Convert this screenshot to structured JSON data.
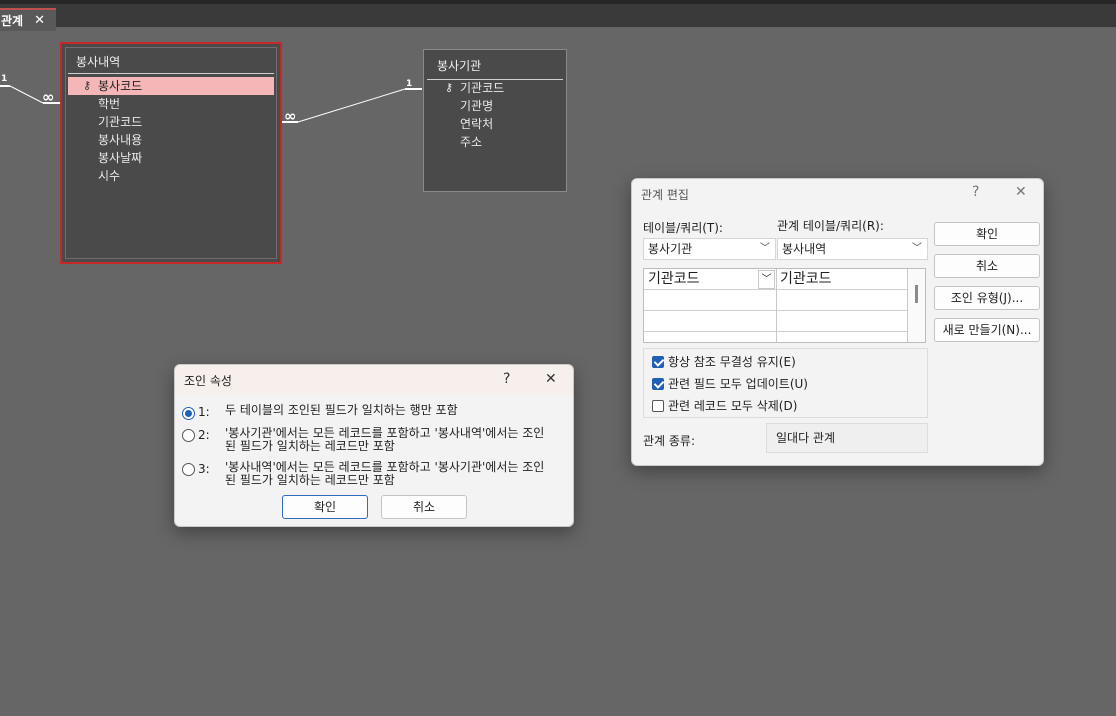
{
  "tab": {
    "label": "관계",
    "close": "✕"
  },
  "tables": [
    {
      "title": "봉사내역",
      "fields": [
        {
          "name": "봉사코드",
          "key": true
        },
        {
          "name": "학번"
        },
        {
          "name": "기관코드"
        },
        {
          "name": "봉사내용"
        },
        {
          "name": "봉사날짜"
        },
        {
          "name": "시수"
        }
      ]
    },
    {
      "title": "봉사기관",
      "fields": [
        {
          "name": "기관코드",
          "key": true
        },
        {
          "name": "기관명"
        },
        {
          "name": "연락처"
        },
        {
          "name": "주소"
        }
      ]
    }
  ],
  "relation_labels": {
    "one": "1",
    "many": "∞"
  },
  "edit_dialog": {
    "title": "관계 편집",
    "help": "?",
    "close": "✕",
    "table_query_label": "테이블/쿼리(T):",
    "related_table_label": "관계 테이블/쿼리(R):",
    "table_value": "봉사기관",
    "related_value": "봉사내역",
    "grid": {
      "left_field": "기관코드",
      "right_field": "기관코드"
    },
    "buttons": {
      "ok": "확인",
      "cancel": "취소",
      "join_type": "조인 유형(J)...",
      "create_new": "새로 만들기(N)..."
    },
    "checks": [
      {
        "label": "항상 참조 무결성 유지(E)",
        "checked": true
      },
      {
        "label": "관련 필드 모두 업데이트(U)",
        "checked": true
      },
      {
        "label": "관련 레코드 모두 삭제(D)",
        "checked": false
      }
    ],
    "relation_type_label": "관계 종류:",
    "relation_type_value": "일대다 관계"
  },
  "join_dialog": {
    "title": "조인 속성",
    "help": "?",
    "close": "✕",
    "options": [
      {
        "num": "1:",
        "line1": "두 테이블의 조인된 필드가 일치하는 행만 포함",
        "line2": "",
        "selected": true
      },
      {
        "num": "2:",
        "line1": "'봉사기관'에서는 모든 레코드를 포함하고 '봉사내역'에서는 조인",
        "line2": "된 필드가 일치하는 레코드만 포함",
        "selected": false
      },
      {
        "num": "3:",
        "line1": "'봉사내역'에서는 모든 레코드를 포함하고 '봉사기관'에서는 조인",
        "line2": "된 필드가 일치하는 레코드만 포함",
        "selected": false
      }
    ],
    "ok": "확인",
    "cancel": "취소"
  }
}
